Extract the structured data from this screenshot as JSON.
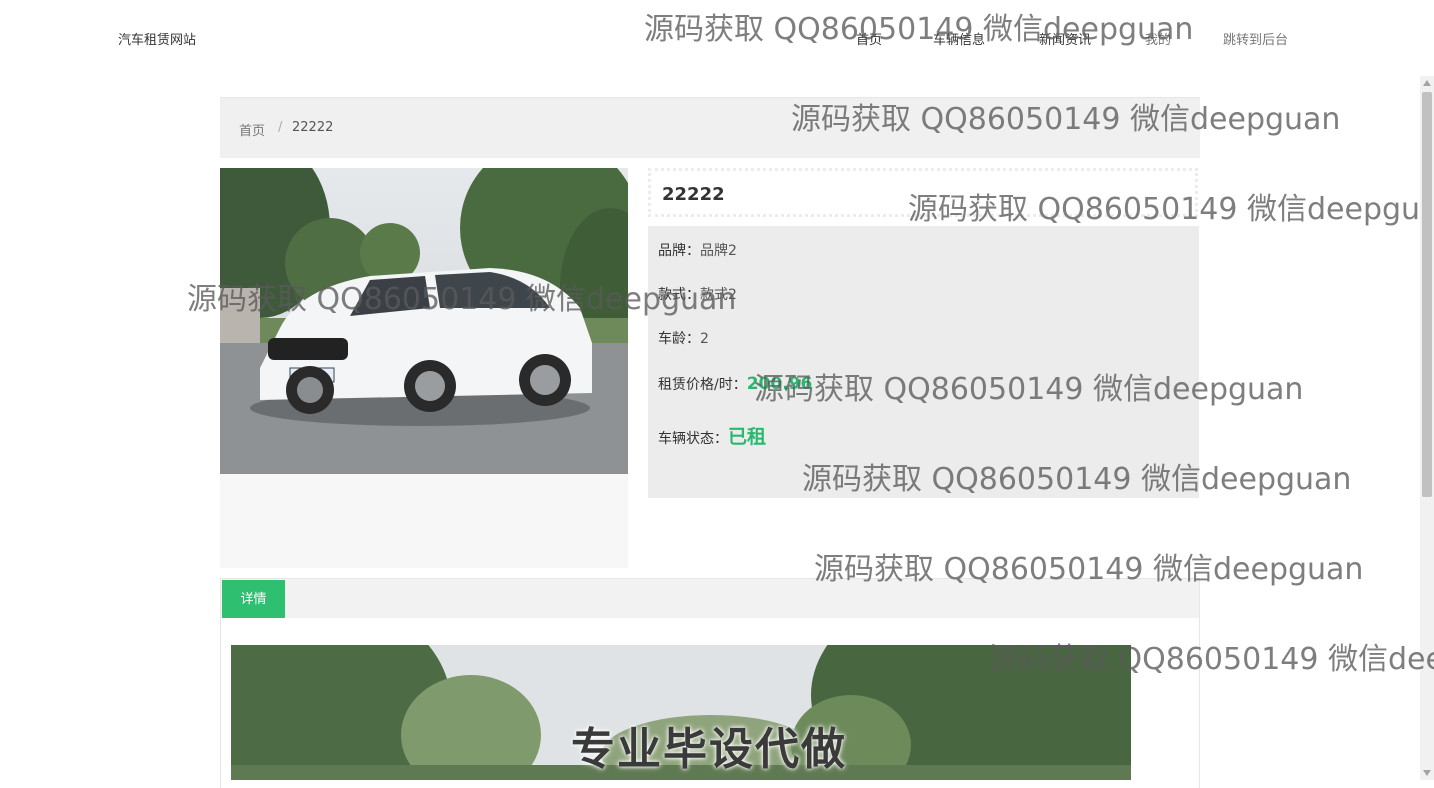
{
  "header": {
    "site_title": "汽车租赁网站",
    "nav": [
      "首页",
      "车辆信息",
      "新闻资讯",
      "我的",
      "跳转到后台"
    ]
  },
  "breadcrumb": {
    "home": "首页",
    "separator": "/",
    "current": "22222"
  },
  "car": {
    "name": "22222",
    "brand_label": "品牌：",
    "brand_value": "品牌2",
    "style_label": "款式：",
    "style_value": "款式2",
    "age_label": "车龄：",
    "age_value": "2",
    "price_label": "租赁价格/时：",
    "price_value": "200.96",
    "status_label": "车辆状态：",
    "status_value": "已租"
  },
  "tabs": {
    "detail": "详情"
  },
  "banner": {
    "text": "专业毕设代做"
  },
  "watermark": "源码获取 QQ86050149 微信deepguan",
  "colors": {
    "accent": "#2fbf71",
    "status": "#2ab76f"
  }
}
